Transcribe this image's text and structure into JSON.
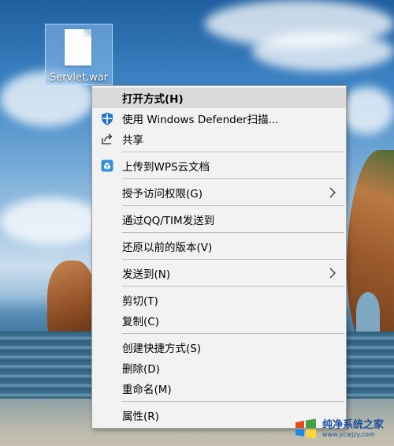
{
  "desktop": {
    "file_icon": {
      "icon": "file-icon",
      "label": "Servlet.war"
    }
  },
  "context_menu": {
    "items": [
      {
        "label": "打开方式(H)",
        "icon": null,
        "bold": true,
        "highlight": true,
        "submenu": false
      },
      {
        "label": "使用 Windows Defender扫描...",
        "icon": "windows-defender-icon",
        "submenu": false
      },
      {
        "label": "共享",
        "icon": "share-icon",
        "submenu": false
      },
      {
        "label": "上传到WPS云文档",
        "icon": "wps-cloud-icon",
        "submenu": false
      },
      {
        "label": "授予访问权限(G)",
        "icon": null,
        "submenu": true
      },
      {
        "label": "通过QQ/TIM发送到",
        "icon": null,
        "submenu": false
      },
      {
        "label": "还原以前的版本(V)",
        "icon": null,
        "submenu": false
      },
      {
        "label": "发送到(N)",
        "icon": null,
        "submenu": true
      },
      {
        "label": "剪切(T)",
        "icon": null,
        "submenu": false
      },
      {
        "label": "复制(C)",
        "icon": null,
        "submenu": false
      },
      {
        "label": "创建快捷方式(S)",
        "icon": null,
        "submenu": false
      },
      {
        "label": "删除(D)",
        "icon": null,
        "submenu": false
      },
      {
        "label": "重命名(M)",
        "icon": null,
        "submenu": false
      },
      {
        "label": "属性(R)",
        "icon": null,
        "submenu": false
      }
    ]
  },
  "watermark": {
    "title": "纯净系统之家",
    "url": "www.ycwjzy.com"
  },
  "colors": {
    "menu_bg": "#f2f2f2",
    "highlight": "#dadada",
    "defender_blue": "#1e6fd0",
    "wps_blue": "#2f8fd8"
  }
}
